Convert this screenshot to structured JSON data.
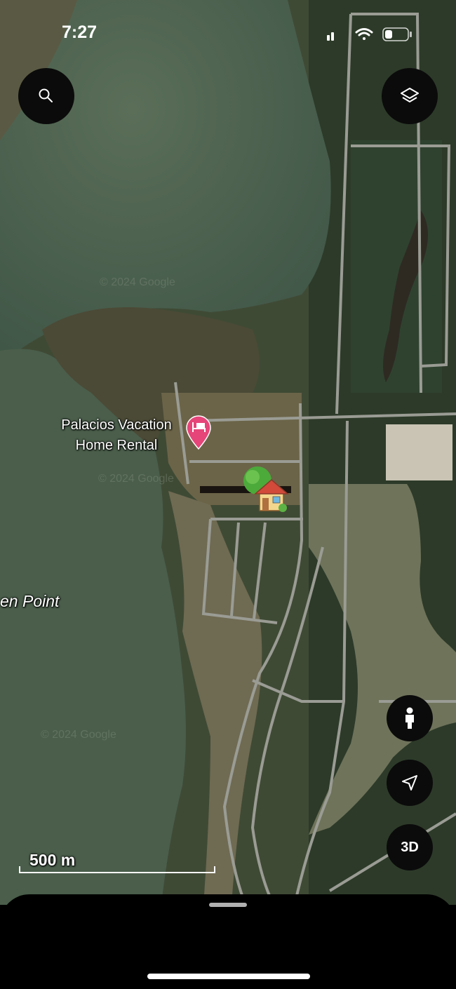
{
  "status_bar": {
    "time": "7:27"
  },
  "map": {
    "type": "satellite",
    "watermark": "© 2024 Google",
    "pin": {
      "label_line1": "Palacios Vacation",
      "label_line2": "Home Rental",
      "icon": "bed-icon",
      "color": "#e6457a"
    },
    "place_label": "en Point",
    "home_marker": "house-emoji",
    "scale": {
      "label": "500 m"
    }
  },
  "controls": {
    "search_icon": "search-icon",
    "layers_icon": "layers-icon",
    "street_view_icon": "person-icon",
    "location_icon": "navigation-arrow-icon",
    "threed_label": "3D"
  }
}
